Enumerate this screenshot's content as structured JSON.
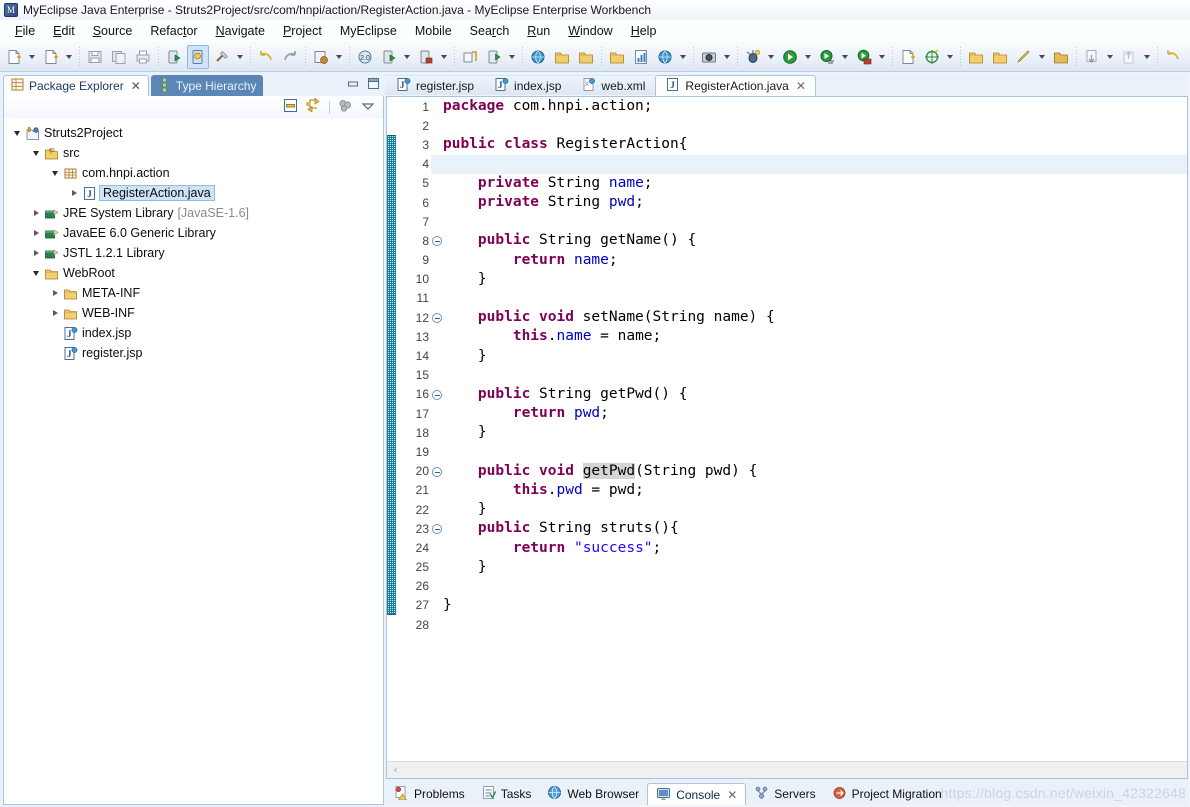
{
  "window": {
    "title": "MyEclipse Java Enterprise - Struts2Project/src/com/hnpi/action/RegisterAction.java - MyEclipse Enterprise Workbench",
    "app_icon": "myeclipse-icon"
  },
  "menubar": {
    "items": [
      {
        "label": "File",
        "mnemonic": "F"
      },
      {
        "label": "Edit",
        "mnemonic": "E"
      },
      {
        "label": "Source",
        "mnemonic": "S"
      },
      {
        "label": "Refactor",
        "mnemonic": "t"
      },
      {
        "label": "Navigate",
        "mnemonic": "N"
      },
      {
        "label": "Project",
        "mnemonic": "P"
      },
      {
        "label": "MyEclipse",
        "mnemonic": ""
      },
      {
        "label": "Mobile",
        "mnemonic": ""
      },
      {
        "label": "Search",
        "mnemonic": "r"
      },
      {
        "label": "Run",
        "mnemonic": "R"
      },
      {
        "label": "Window",
        "mnemonic": "W"
      },
      {
        "label": "Help",
        "mnemonic": "H"
      }
    ]
  },
  "toolbar": {
    "groups": [
      [
        "new-wizard-icon",
        "dropdown",
        "new-item-icon",
        "dropdown"
      ],
      [
        "save-icon",
        "save-all-icon",
        "print-icon"
      ],
      [
        "run-last-tool-icon",
        "myeclipse-web-icon",
        "build-hammer-icon",
        "dropdown"
      ],
      [
        "undo-arrow-icon",
        "redo-arrow-icon"
      ],
      [
        "deploy-icon",
        "dropdown"
      ],
      [
        "db-explorer-icon",
        "run-server-icon",
        "dropdown",
        "stop-server-icon",
        "dropdown"
      ],
      [
        "sync-icon",
        "new-server-icon",
        "dropdown"
      ],
      [
        "web-globe-icon",
        "open-folder-icon",
        "import-icon"
      ],
      [
        "export-icon",
        "report-icon",
        "globe-link-icon",
        "dropdown"
      ],
      [
        "capture-icon",
        "dropdown"
      ],
      [
        "debug-bug-icon",
        "dropdown",
        "run-green-icon",
        "dropdown",
        "profile-icon",
        "dropdown",
        "coverage-icon",
        "dropdown"
      ],
      [
        "new-package-icon",
        "search-target-icon",
        "dropdown"
      ],
      [
        "open-type-icon",
        "open-resource-icon",
        "pencil-icon",
        "dropdown",
        "annotate-icon"
      ],
      [
        "next-annotation-icon",
        "dropdown",
        "prev-annotation-icon",
        "dropdown"
      ],
      [
        "back-arrow-icon",
        "forward-arrow-icon"
      ]
    ]
  },
  "package_explorer": {
    "tabs": [
      {
        "label": "Package Explorer",
        "icon": "package-explorer-icon",
        "selected": true,
        "closable": true
      },
      {
        "label": "Type Hierarchy",
        "icon": "type-hierarchy-icon",
        "selected": false,
        "closable": false
      }
    ],
    "window_buttons": [
      "minimize-icon",
      "maximize-icon"
    ],
    "view_toolbar": [
      "collapse-all-icon",
      "link-with-editor-icon",
      "view-filters-icon",
      "view-menu-chevron-icon"
    ],
    "tree": [
      {
        "label": "Struts2Project",
        "indent": 0,
        "twisty": "open",
        "icon": "java-project-icon",
        "selected": false
      },
      {
        "label": "src",
        "indent": 1,
        "twisty": "open",
        "icon": "source-folder-icon",
        "selected": false
      },
      {
        "label": "com.hnpi.action",
        "indent": 2,
        "twisty": "open",
        "icon": "package-icon",
        "selected": false
      },
      {
        "label": "RegisterAction.java",
        "indent": 3,
        "twisty": "closed",
        "icon": "java-file-icon",
        "selected": true
      },
      {
        "label": "JRE System Library",
        "suffix": "[JavaSE-1.6]",
        "indent": 1,
        "twisty": "closed",
        "icon": "library-icon",
        "selected": false
      },
      {
        "label": "JavaEE 6.0 Generic Library",
        "indent": 1,
        "twisty": "closed",
        "icon": "library-icon",
        "selected": false
      },
      {
        "label": "JSTL 1.2.1 Library",
        "indent": 1,
        "twisty": "closed",
        "icon": "library-icon",
        "selected": false
      },
      {
        "label": "WebRoot",
        "indent": 1,
        "twisty": "open",
        "icon": "folder-icon",
        "selected": false
      },
      {
        "label": "META-INF",
        "indent": 2,
        "twisty": "closed",
        "icon": "folder-icon",
        "selected": false
      },
      {
        "label": "WEB-INF",
        "indent": 2,
        "twisty": "closed",
        "icon": "folder-icon",
        "selected": false
      },
      {
        "label": "index.jsp",
        "indent": 2,
        "twisty": "none",
        "icon": "jsp-file-icon",
        "selected": false
      },
      {
        "label": "register.jsp",
        "indent": 2,
        "twisty": "none",
        "icon": "jsp-file-icon",
        "selected": false
      }
    ]
  },
  "editor": {
    "tabs": [
      {
        "label": "register.jsp",
        "icon": "jsp-file-icon",
        "selected": false,
        "closable": false
      },
      {
        "label": "index.jsp",
        "icon": "jsp-file-icon",
        "selected": false,
        "closable": false
      },
      {
        "label": "web.xml",
        "icon": "xml-file-icon",
        "selected": false,
        "closable": false
      },
      {
        "label": "RegisterAction.java",
        "icon": "java-file-icon",
        "selected": true,
        "closable": true
      }
    ],
    "current_line": 4,
    "fold_markers": [
      8,
      12,
      16,
      20,
      23
    ],
    "total_lines": 28,
    "lines": [
      {
        "n": 1,
        "tokens": [
          {
            "t": "package",
            "c": "kw"
          },
          {
            "t": " com.hnpi.action;",
            "c": ""
          }
        ]
      },
      {
        "n": 2,
        "tokens": []
      },
      {
        "n": 3,
        "tokens": [
          {
            "t": "public class",
            "c": "kw"
          },
          {
            "t": " RegisterAction{",
            "c": ""
          }
        ]
      },
      {
        "n": 4,
        "tokens": []
      },
      {
        "n": 5,
        "tokens": [
          {
            "t": "    ",
            "c": ""
          },
          {
            "t": "private",
            "c": "kw"
          },
          {
            "t": " String ",
            "c": ""
          },
          {
            "t": "name",
            "c": "fld"
          },
          {
            "t": ";",
            "c": ""
          }
        ]
      },
      {
        "n": 6,
        "tokens": [
          {
            "t": "    ",
            "c": ""
          },
          {
            "t": "private",
            "c": "kw"
          },
          {
            "t": " String ",
            "c": ""
          },
          {
            "t": "pwd",
            "c": "fld"
          },
          {
            "t": ";",
            "c": ""
          }
        ]
      },
      {
        "n": 7,
        "tokens": []
      },
      {
        "n": 8,
        "tokens": [
          {
            "t": "    ",
            "c": ""
          },
          {
            "t": "public",
            "c": "kw"
          },
          {
            "t": " String getName() {",
            "c": ""
          }
        ]
      },
      {
        "n": 9,
        "tokens": [
          {
            "t": "        ",
            "c": ""
          },
          {
            "t": "return",
            "c": "kw"
          },
          {
            "t": " ",
            "c": ""
          },
          {
            "t": "name",
            "c": "fld"
          },
          {
            "t": ";",
            "c": ""
          }
        ]
      },
      {
        "n": 10,
        "tokens": [
          {
            "t": "    }",
            "c": ""
          }
        ]
      },
      {
        "n": 11,
        "tokens": []
      },
      {
        "n": 12,
        "tokens": [
          {
            "t": "    ",
            "c": ""
          },
          {
            "t": "public void",
            "c": "kw"
          },
          {
            "t": " setName(String name) {",
            "c": ""
          }
        ]
      },
      {
        "n": 13,
        "tokens": [
          {
            "t": "        ",
            "c": ""
          },
          {
            "t": "this",
            "c": "kw"
          },
          {
            "t": ".",
            "c": ""
          },
          {
            "t": "name",
            "c": "fld"
          },
          {
            "t": " = name;",
            "c": ""
          }
        ]
      },
      {
        "n": 14,
        "tokens": [
          {
            "t": "    }",
            "c": ""
          }
        ]
      },
      {
        "n": 15,
        "tokens": []
      },
      {
        "n": 16,
        "tokens": [
          {
            "t": "    ",
            "c": ""
          },
          {
            "t": "public",
            "c": "kw"
          },
          {
            "t": " String getPwd() {",
            "c": ""
          }
        ]
      },
      {
        "n": 17,
        "tokens": [
          {
            "t": "        ",
            "c": ""
          },
          {
            "t": "return",
            "c": "kw"
          },
          {
            "t": " ",
            "c": ""
          },
          {
            "t": "pwd",
            "c": "fld"
          },
          {
            "t": ";",
            "c": ""
          }
        ]
      },
      {
        "n": 18,
        "tokens": [
          {
            "t": "    }",
            "c": ""
          }
        ]
      },
      {
        "n": 19,
        "tokens": []
      },
      {
        "n": 20,
        "tokens": [
          {
            "t": "    ",
            "c": ""
          },
          {
            "t": "public void",
            "c": "kw"
          },
          {
            "t": " ",
            "c": ""
          },
          {
            "t": "getPwd",
            "c": "hl"
          },
          {
            "t": "(String pwd) {",
            "c": ""
          }
        ]
      },
      {
        "n": 21,
        "tokens": [
          {
            "t": "        ",
            "c": ""
          },
          {
            "t": "this",
            "c": "kw"
          },
          {
            "t": ".",
            "c": ""
          },
          {
            "t": "pwd",
            "c": "fld"
          },
          {
            "t": " = pwd;",
            "c": ""
          }
        ]
      },
      {
        "n": 22,
        "tokens": [
          {
            "t": "    }",
            "c": ""
          }
        ]
      },
      {
        "n": 23,
        "tokens": [
          {
            "t": "    ",
            "c": ""
          },
          {
            "t": "public",
            "c": "kw"
          },
          {
            "t": " String struts(){",
            "c": ""
          }
        ]
      },
      {
        "n": 24,
        "tokens": [
          {
            "t": "        ",
            "c": ""
          },
          {
            "t": "return",
            "c": "kw"
          },
          {
            "t": " ",
            "c": ""
          },
          {
            "t": "\"success\"",
            "c": "str"
          },
          {
            "t": ";",
            "c": ""
          }
        ]
      },
      {
        "n": 25,
        "tokens": [
          {
            "t": "    }",
            "c": ""
          }
        ]
      },
      {
        "n": 26,
        "tokens": []
      },
      {
        "n": 27,
        "tokens": [
          {
            "t": "}",
            "c": ""
          }
        ]
      },
      {
        "n": 28,
        "tokens": []
      }
    ],
    "hscroll_left_arrow": "‹"
  },
  "bottom_views": {
    "tabs": [
      {
        "label": "Problems",
        "icon": "problems-icon",
        "selected": false,
        "closable": false
      },
      {
        "label": "Tasks",
        "icon": "tasks-icon",
        "selected": false,
        "closable": false
      },
      {
        "label": "Web Browser",
        "icon": "web-browser-icon",
        "selected": false,
        "closable": false
      },
      {
        "label": "Console",
        "icon": "console-icon",
        "selected": true,
        "closable": true
      },
      {
        "label": "Servers",
        "icon": "servers-icon",
        "selected": false,
        "closable": false
      },
      {
        "label": "Project Migration",
        "icon": "project-migration-icon",
        "selected": false,
        "closable": false
      }
    ]
  },
  "watermark": {
    "text": "https://blog.csdn.net/weixin_42322648"
  },
  "colors": {
    "keyword": "#7f0055",
    "field": "#0000c0",
    "string": "#2a00ff",
    "current_line": "#e8f2fb",
    "selection": "#cde4f7",
    "tab_unselected_bg": "#5b86b5",
    "fold_bar": "#1b7f96"
  }
}
